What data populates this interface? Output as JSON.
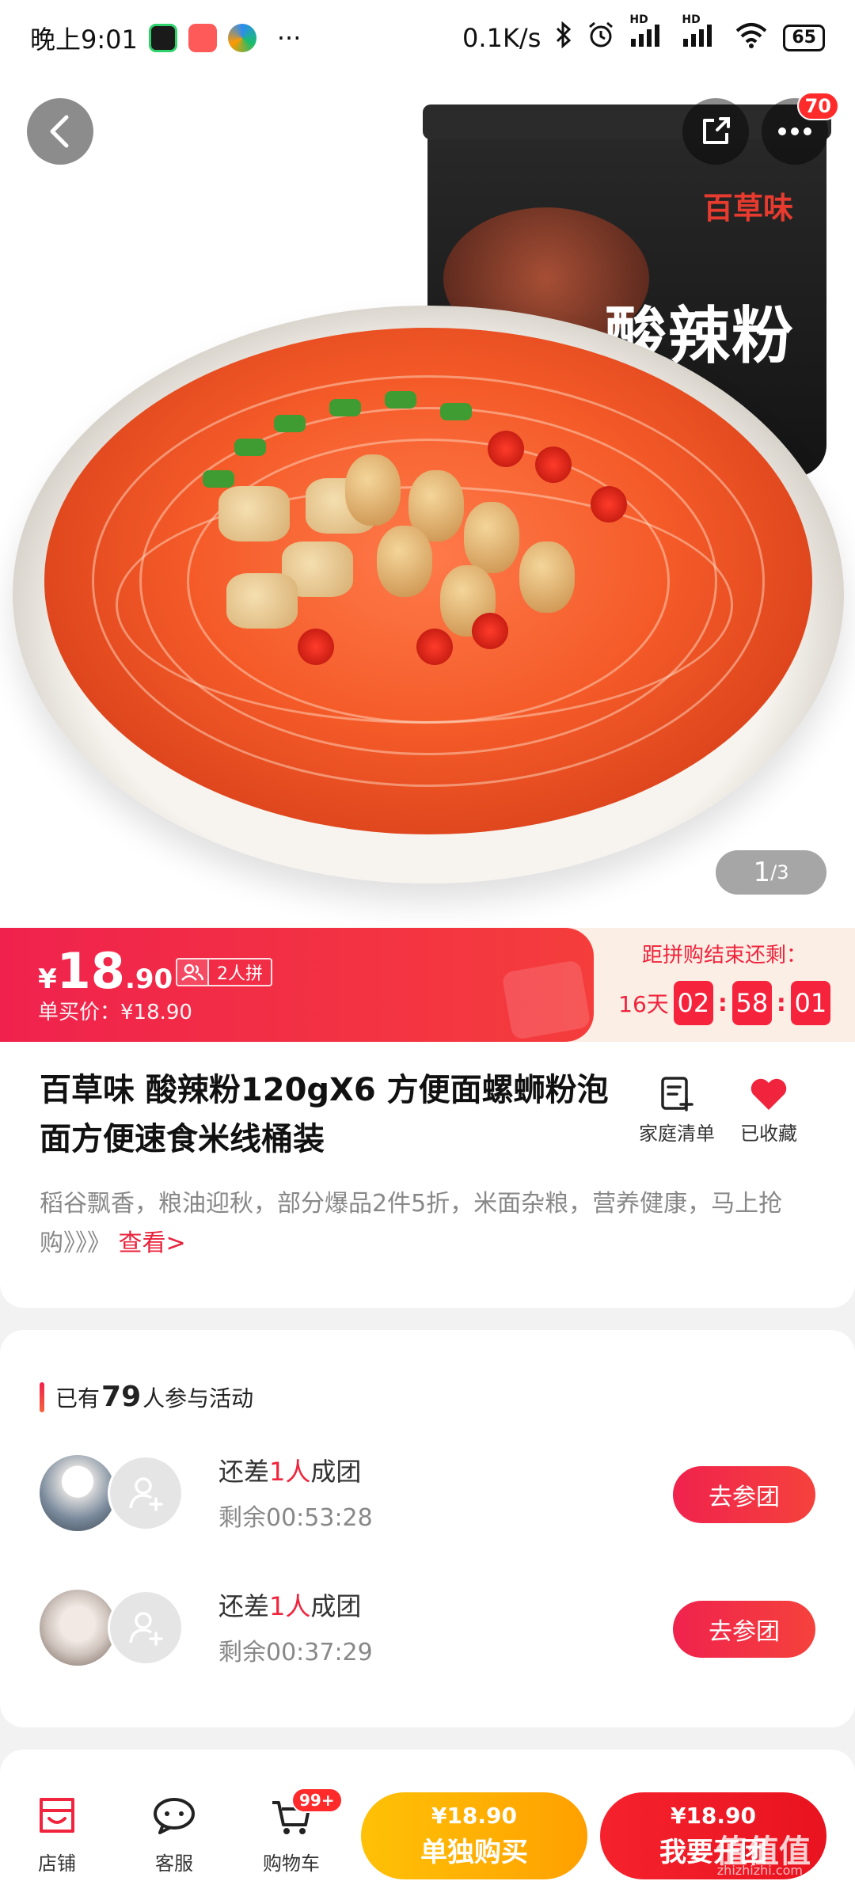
{
  "status_bar": {
    "time": "晚上9:01",
    "more": "···",
    "net_speed": "0.1K/s",
    "hd1": "HD",
    "hd2": "HD",
    "battery": "65"
  },
  "hero": {
    "cup_brand": "百草味",
    "cup_title": "酸辣粉",
    "badge_count": "70",
    "pager_current": "1",
    "pager_total": "/3"
  },
  "price": {
    "currency": "¥",
    "integer": "18",
    "decimal": ".90",
    "group_label": "2人拼",
    "single_price": "单买价：¥18.90"
  },
  "countdown": {
    "title": "距拼购结束还剩：",
    "days": "16天",
    "hours": "02",
    "minutes": "58",
    "seconds": "01"
  },
  "product": {
    "title": "百草味 酸辣粉120gX6 方便面螺蛳粉泡面方便速食米线桶装",
    "action_list": "家庭清单",
    "action_fav": "已收藏",
    "promo_text": "稻谷飘香，粮油迎秋，部分爆品2件5折，米面杂粮，营养健康，马上抢购》》》",
    "promo_link": "查看>"
  },
  "group": {
    "head_prefix": "已有",
    "head_count": "79",
    "head_suffix": "人参与活动",
    "rows": [
      {
        "prefix": "还差",
        "count": "1人",
        "suffix": "成团",
        "remaining": "剩余00:53:28",
        "button": "去参团"
      },
      {
        "prefix": "还差",
        "count": "1人",
        "suffix": "成团",
        "remaining": "剩余00:37:29",
        "button": "去参团"
      }
    ]
  },
  "bottom": {
    "shop": "店铺",
    "service": "客服",
    "cart": "购物车",
    "cart_badge": "99+",
    "single_price": "¥18.90",
    "single_label": "单独购买",
    "group_price": "¥18.90",
    "group_label": "我要开团",
    "watermark": "值值值",
    "watermark_sub": "zhizhizhi.com"
  },
  "colors": {
    "accent": "#f0243c",
    "orange_button": "#ffb300",
    "red_button": "#ed1c24"
  }
}
